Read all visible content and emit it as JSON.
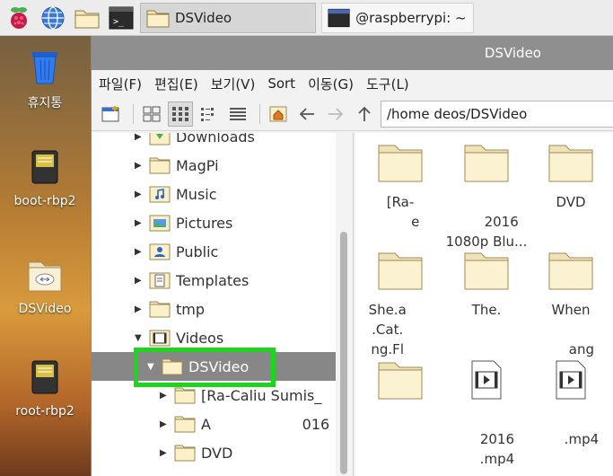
{
  "taskbar": {
    "tasks": [
      {
        "label": "DSVideo"
      },
      {
        "label": "@raspberrypi: ~]"
      }
    ]
  },
  "desktop": {
    "icons": [
      {
        "label": "휴지통"
      },
      {
        "label": "boot-rbp2"
      },
      {
        "label": "DSVideo"
      },
      {
        "label": "root-rbp2"
      }
    ]
  },
  "window": {
    "title": "DSVideo",
    "menu": [
      "파일(F)",
      "편집(E)",
      "보기(V)",
      "Sort",
      "이동(G)",
      "도구(L)"
    ],
    "path": "/home      deos/DSVideo"
  },
  "tree": {
    "items": [
      {
        "label": "Downloads"
      },
      {
        "label": "MagPi"
      },
      {
        "label": "Music"
      },
      {
        "label": "Pictures"
      },
      {
        "label": "Public"
      },
      {
        "label": "Templates"
      },
      {
        "label": "tmp"
      },
      {
        "label": "Videos"
      },
      {
        "label": "DSVideo"
      },
      {
        "label": "[Ra-Caliu      Sumis_"
      },
      {
        "label": "A                    016"
      },
      {
        "label": "DVD"
      }
    ]
  },
  "files": {
    "items": [
      {
        "line1": "[Ra-",
        "line2": "       e",
        "line3": "      "
      },
      {
        "line1": "        ",
        "line2": "       2016",
        "line3": "1080p Blu..."
      },
      {
        "line1": "DVD",
        "line2": "",
        "line3": ""
      },
      {
        "line1": "She.a      ",
        "line2": ".Cat.      ",
        "line3": "ng.Fl      "
      },
      {
        "line1": "The.",
        "line2": "       ",
        "line3": "       "
      },
      {
        "line1": "When",
        "line2": "       ",
        "line3": "     ang"
      },
      {
        "line1": "      ",
        "line2": "      ",
        "line3": ""
      },
      {
        "line1": "      ",
        "line2": "     2016",
        "line3": "     .mp4"
      },
      {
        "line1": "      ",
        "line2": "     .mp4",
        "line3": ""
      }
    ]
  },
  "colors": {
    "highlight": "#1ed41e",
    "titlebar": "#8f8f8f",
    "selection": "#878787"
  }
}
